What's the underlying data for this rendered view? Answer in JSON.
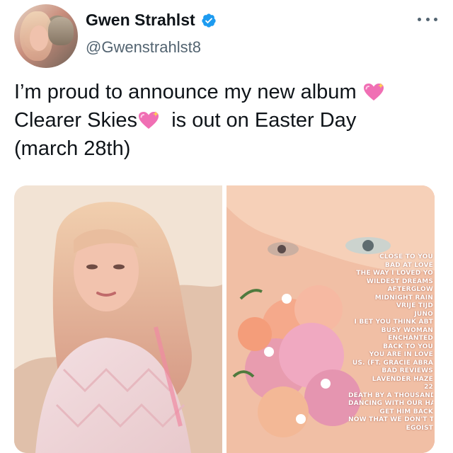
{
  "tweet": {
    "display_name": "Gwen Strahlst",
    "handle": "@Gwenstrahlst8",
    "verified": true,
    "text_lines": [
      "I’m proud to announce my new album",
      "Clearer Skies",
      "is out on Easter Day",
      "(march 28th)"
    ]
  },
  "media": {
    "tracklist": [
      "CLOSE TO YOU",
      "BAD AT LOVE",
      "THE WAY I LOVED YO",
      "WILDEST DREAMS",
      "AFTERGLOW",
      "MIDNIGHT RAIN",
      "VRIJE TIJD",
      "JUNO",
      "I BET YOU THINK ABT",
      "BUSY WOMAN",
      "ENCHANTED",
      "BACK TO YOU",
      "YOU ARE IN LOVE",
      "US. (FT. GRACIE ABRA",
      "BAD REVIEWS",
      "LAVENDER HAZE",
      "22",
      "DEATH BY A THOUSAND",
      "DANCING WITH OUR HAND",
      "GET HIM BACK",
      "NOW THAT WE DON'T T",
      "EGOIST"
    ]
  },
  "icons": {
    "verified": "verified-badge-icon",
    "more": "more-options-icon",
    "emoji": "sparkling-heart-emoji"
  },
  "colors": {
    "verified_blue": "#1d9bf0",
    "heart_pink": "#f06fb4",
    "handle_gray": "#536471"
  }
}
